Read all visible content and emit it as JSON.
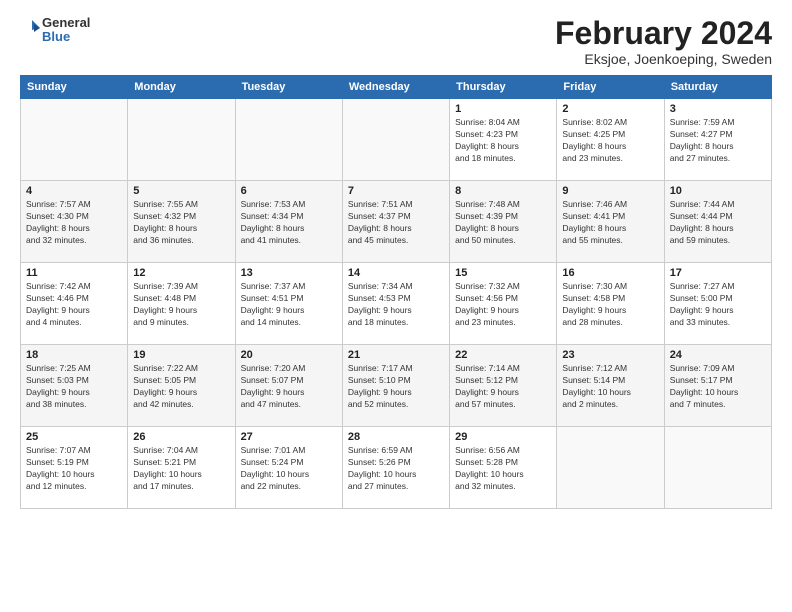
{
  "logo": {
    "general": "General",
    "blue": "Blue"
  },
  "title": "February 2024",
  "location": "Eksjoe, Joenkoeping, Sweden",
  "weekdays": [
    "Sunday",
    "Monday",
    "Tuesday",
    "Wednesday",
    "Thursday",
    "Friday",
    "Saturday"
  ],
  "weeks": [
    [
      {
        "day": "",
        "info": ""
      },
      {
        "day": "",
        "info": ""
      },
      {
        "day": "",
        "info": ""
      },
      {
        "day": "",
        "info": ""
      },
      {
        "day": "1",
        "info": "Sunrise: 8:04 AM\nSunset: 4:23 PM\nDaylight: 8 hours\nand 18 minutes."
      },
      {
        "day": "2",
        "info": "Sunrise: 8:02 AM\nSunset: 4:25 PM\nDaylight: 8 hours\nand 23 minutes."
      },
      {
        "day": "3",
        "info": "Sunrise: 7:59 AM\nSunset: 4:27 PM\nDaylight: 8 hours\nand 27 minutes."
      }
    ],
    [
      {
        "day": "4",
        "info": "Sunrise: 7:57 AM\nSunset: 4:30 PM\nDaylight: 8 hours\nand 32 minutes."
      },
      {
        "day": "5",
        "info": "Sunrise: 7:55 AM\nSunset: 4:32 PM\nDaylight: 8 hours\nand 36 minutes."
      },
      {
        "day": "6",
        "info": "Sunrise: 7:53 AM\nSunset: 4:34 PM\nDaylight: 8 hours\nand 41 minutes."
      },
      {
        "day": "7",
        "info": "Sunrise: 7:51 AM\nSunset: 4:37 PM\nDaylight: 8 hours\nand 45 minutes."
      },
      {
        "day": "8",
        "info": "Sunrise: 7:48 AM\nSunset: 4:39 PM\nDaylight: 8 hours\nand 50 minutes."
      },
      {
        "day": "9",
        "info": "Sunrise: 7:46 AM\nSunset: 4:41 PM\nDaylight: 8 hours\nand 55 minutes."
      },
      {
        "day": "10",
        "info": "Sunrise: 7:44 AM\nSunset: 4:44 PM\nDaylight: 8 hours\nand 59 minutes."
      }
    ],
    [
      {
        "day": "11",
        "info": "Sunrise: 7:42 AM\nSunset: 4:46 PM\nDaylight: 9 hours\nand 4 minutes."
      },
      {
        "day": "12",
        "info": "Sunrise: 7:39 AM\nSunset: 4:48 PM\nDaylight: 9 hours\nand 9 minutes."
      },
      {
        "day": "13",
        "info": "Sunrise: 7:37 AM\nSunset: 4:51 PM\nDaylight: 9 hours\nand 14 minutes."
      },
      {
        "day": "14",
        "info": "Sunrise: 7:34 AM\nSunset: 4:53 PM\nDaylight: 9 hours\nand 18 minutes."
      },
      {
        "day": "15",
        "info": "Sunrise: 7:32 AM\nSunset: 4:56 PM\nDaylight: 9 hours\nand 23 minutes."
      },
      {
        "day": "16",
        "info": "Sunrise: 7:30 AM\nSunset: 4:58 PM\nDaylight: 9 hours\nand 28 minutes."
      },
      {
        "day": "17",
        "info": "Sunrise: 7:27 AM\nSunset: 5:00 PM\nDaylight: 9 hours\nand 33 minutes."
      }
    ],
    [
      {
        "day": "18",
        "info": "Sunrise: 7:25 AM\nSunset: 5:03 PM\nDaylight: 9 hours\nand 38 minutes."
      },
      {
        "day": "19",
        "info": "Sunrise: 7:22 AM\nSunset: 5:05 PM\nDaylight: 9 hours\nand 42 minutes."
      },
      {
        "day": "20",
        "info": "Sunrise: 7:20 AM\nSunset: 5:07 PM\nDaylight: 9 hours\nand 47 minutes."
      },
      {
        "day": "21",
        "info": "Sunrise: 7:17 AM\nSunset: 5:10 PM\nDaylight: 9 hours\nand 52 minutes."
      },
      {
        "day": "22",
        "info": "Sunrise: 7:14 AM\nSunset: 5:12 PM\nDaylight: 9 hours\nand 57 minutes."
      },
      {
        "day": "23",
        "info": "Sunrise: 7:12 AM\nSunset: 5:14 PM\nDaylight: 10 hours\nand 2 minutes."
      },
      {
        "day": "24",
        "info": "Sunrise: 7:09 AM\nSunset: 5:17 PM\nDaylight: 10 hours\nand 7 minutes."
      }
    ],
    [
      {
        "day": "25",
        "info": "Sunrise: 7:07 AM\nSunset: 5:19 PM\nDaylight: 10 hours\nand 12 minutes."
      },
      {
        "day": "26",
        "info": "Sunrise: 7:04 AM\nSunset: 5:21 PM\nDaylight: 10 hours\nand 17 minutes."
      },
      {
        "day": "27",
        "info": "Sunrise: 7:01 AM\nSunset: 5:24 PM\nDaylight: 10 hours\nand 22 minutes."
      },
      {
        "day": "28",
        "info": "Sunrise: 6:59 AM\nSunset: 5:26 PM\nDaylight: 10 hours\nand 27 minutes."
      },
      {
        "day": "29",
        "info": "Sunrise: 6:56 AM\nSunset: 5:28 PM\nDaylight: 10 hours\nand 32 minutes."
      },
      {
        "day": "",
        "info": ""
      },
      {
        "day": "",
        "info": ""
      }
    ]
  ]
}
